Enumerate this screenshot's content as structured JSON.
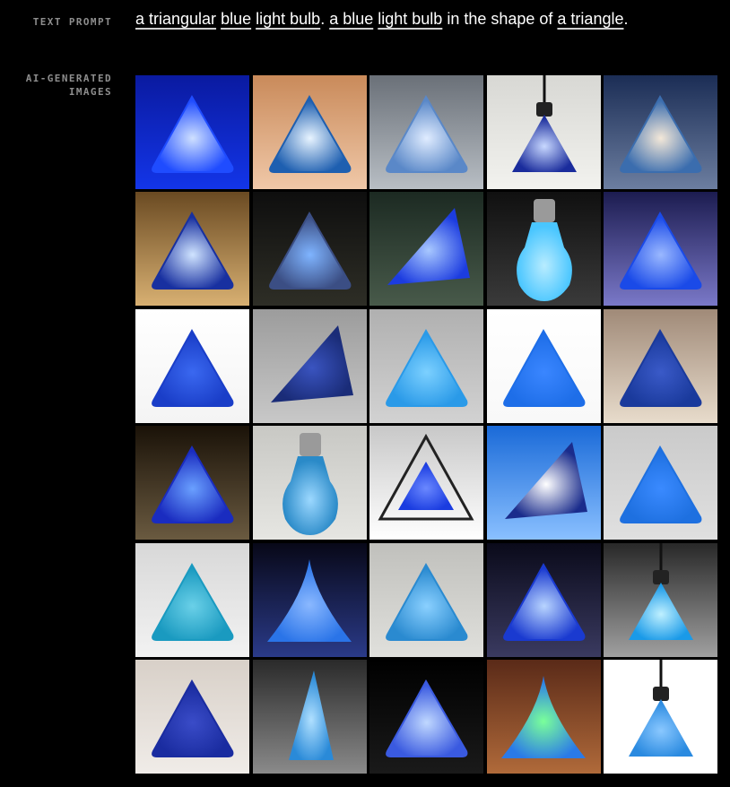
{
  "labels": {
    "text_prompt": "TEXT PROMPT",
    "ai_generated": "AI-GENERATED\nIMAGES"
  },
  "prompt": {
    "segments": [
      {
        "text": "a triangular",
        "chip": true
      },
      {
        "text": " ",
        "chip": false
      },
      {
        "text": "blue",
        "chip": true
      },
      {
        "text": " ",
        "chip": false
      },
      {
        "text": "light bulb",
        "chip": true
      },
      {
        "text": ". ",
        "chip": false
      },
      {
        "text": "a blue",
        "chip": true
      },
      {
        "text": " ",
        "chip": false
      },
      {
        "text": "light bulb",
        "chip": true
      },
      {
        "text": " in the shape of ",
        "chip": false
      },
      {
        "text": "a triangle",
        "chip": true
      },
      {
        "text": ".",
        "chip": false
      }
    ]
  },
  "colors": {
    "background": "#000000",
    "label": "#8e8e8e",
    "prompt_text": "#ffffff"
  },
  "images": [
    {
      "name": "blue-triangle-lamp-dark",
      "kind": "tri",
      "bg1": "#0a1aa0",
      "bg2": "#1335e8",
      "fill": "#1f4cff",
      "glow": "#cfe0ff"
    },
    {
      "name": "glass-triangle-warm-light",
      "kind": "tri",
      "bg1": "#c98a5a",
      "bg2": "#f0c8a8",
      "fill": "#1e5fb0",
      "glow": "#e8f4ff"
    },
    {
      "name": "hanging-glass-triangle",
      "kind": "tri",
      "bg1": "#6a7078",
      "bg2": "#b8bec4",
      "fill": "#5a88c8",
      "glow": "#e0ecff"
    },
    {
      "name": "pendant-bulb-triangle",
      "kind": "pendant",
      "bg1": "#d8d8d4",
      "bg2": "#f2f2ee",
      "fill": "#1a2c9c",
      "glow": "#c8d8ff"
    },
    {
      "name": "crystal-triangle-bulb",
      "kind": "tri",
      "bg1": "#1b2d55",
      "bg2": "#6c7ea0",
      "fill": "#3b6dae",
      "glow": "#f4e8d8"
    },
    {
      "name": "glowing-triangle-amber",
      "kind": "tri",
      "bg1": "#6a4a22",
      "bg2": "#d8b072",
      "fill": "#1830a0",
      "glow": "#d0e4ff"
    },
    {
      "name": "clear-triangle-dark",
      "kind": "tri",
      "bg1": "#0e0e0e",
      "bg2": "#2e2e26",
      "fill": "#3b4e84",
      "glow": "#7fb4ff"
    },
    {
      "name": "blue-wedge-closeup",
      "kind": "wedge",
      "bg1": "#1c2a22",
      "bg2": "#485a4a",
      "fill": "#1c3ce0",
      "glow": "#a8c8ff"
    },
    {
      "name": "classic-blue-bulb",
      "kind": "bulb",
      "bg1": "#101010",
      "bg2": "#3a3a3a",
      "fill": "#4ac6ff",
      "glow": "#b8ecff"
    },
    {
      "name": "triangle-on-mirror",
      "kind": "tri",
      "bg1": "#1c1c50",
      "bg2": "#7a78c8",
      "fill": "#1a4ae8",
      "glow": "#9ab8ff"
    },
    {
      "name": "rounded-triangle-white",
      "kind": "tri",
      "bg1": "#ffffff",
      "bg2": "#f4f4f4",
      "fill": "#1a3ec8",
      "glow": "#3a68f0"
    },
    {
      "name": "blue-cone-gray",
      "kind": "wedge",
      "bg1": "#9c9c9c",
      "bg2": "#c8c8c8",
      "fill": "#1a2c78",
      "glow": "#3a54c0"
    },
    {
      "name": "cyan-triangle-gray",
      "kind": "tri",
      "bg1": "#b0b0b0",
      "bg2": "#d2d2d2",
      "fill": "#2a9ae8",
      "glow": "#7cd0ff"
    },
    {
      "name": "flat-blue-triangle",
      "kind": "tri",
      "bg1": "#ffffff",
      "bg2": "#f8f8f8",
      "fill": "#1e6ee8",
      "glow": "#3a86ff"
    },
    {
      "name": "triangle-on-fur",
      "kind": "tri",
      "bg1": "#a08a78",
      "bg2": "#e8dccc",
      "fill": "#1a3a9c",
      "glow": "#3a5ac8"
    },
    {
      "name": "dark-glowing-pyramid",
      "kind": "tri",
      "bg1": "#1a1208",
      "bg2": "#6a5a40",
      "fill": "#1a2cc0",
      "glow": "#6aa0ff"
    },
    {
      "name": "bulb-with-socket",
      "kind": "bulb",
      "bg1": "#c8c8c4",
      "bg2": "#e6e6e2",
      "fill": "#2a8ac8",
      "glow": "#9cd8ff"
    },
    {
      "name": "outlined-triangle",
      "kind": "outline",
      "bg1": "#c8c8c8",
      "bg2": "#ffffff",
      "fill": "#1a3ce0",
      "glow": "#6a88ff"
    },
    {
      "name": "triangle-lamp-blue-sky",
      "kind": "wedge",
      "bg1": "#1a6ad8",
      "bg2": "#8ac0ff",
      "fill": "#1a2c8c",
      "glow": "#ffffff"
    },
    {
      "name": "simple-triangle-gray",
      "kind": "tri",
      "bg1": "#cacaca",
      "bg2": "#e0e0e0",
      "fill": "#1e70e0",
      "glow": "#3a8aff"
    },
    {
      "name": "teal-glass-triangle",
      "kind": "tri",
      "bg1": "#d8d8d8",
      "bg2": "#f2f2f2",
      "fill": "#1a9ac0",
      "glow": "#6ad0e8"
    },
    {
      "name": "cone-blue-gradient",
      "kind": "cone",
      "bg1": "#080818",
      "bg2": "#2a3a88",
      "fill": "#2a74e8",
      "glow": "#8ab8ff"
    },
    {
      "name": "glass-triangle-tray",
      "kind": "tri",
      "bg1": "#c0c0bc",
      "bg2": "#e0e0dc",
      "fill": "#2a8ad0",
      "glow": "#8ad0ff"
    },
    {
      "name": "plasma-triangle",
      "kind": "tri",
      "bg1": "#0a0a1a",
      "bg2": "#3a3a60",
      "fill": "#1a3ad0",
      "glow": "#b8d4ff"
    },
    {
      "name": "pendant-triangle-lamp",
      "kind": "pendant",
      "bg1": "#282828",
      "bg2": "#a0a0a0",
      "fill": "#1a9ae8",
      "glow": "#bff0ff"
    },
    {
      "name": "rounded-triangle-wood",
      "kind": "tri",
      "bg1": "#d8d0c8",
      "bg2": "#f0ece8",
      "fill": "#1a2ca0",
      "glow": "#3a4cc8"
    },
    {
      "name": "tall-spike-bulb",
      "kind": "spike",
      "bg1": "#2a2a2a",
      "bg2": "#8a8a8a",
      "fill": "#2a8ad8",
      "glow": "#b0e0ff"
    },
    {
      "name": "flat-glowing-triangle",
      "kind": "tri",
      "bg1": "#000000",
      "bg2": "#1a1a1a",
      "fill": "#3a5ae0",
      "glow": "#c0d8ff"
    },
    {
      "name": "cone-lamp-wood-room",
      "kind": "cone",
      "bg1": "#5a2a18",
      "bg2": "#b06a3a",
      "fill": "#2a7ae8",
      "glow": "#7aff9a"
    },
    {
      "name": "pendant-blue-bulb",
      "kind": "pendant",
      "bg1": "#ffffff",
      "bg2": "#ffffff",
      "fill": "#2a8ae0",
      "glow": "#8ac8ff"
    }
  ]
}
